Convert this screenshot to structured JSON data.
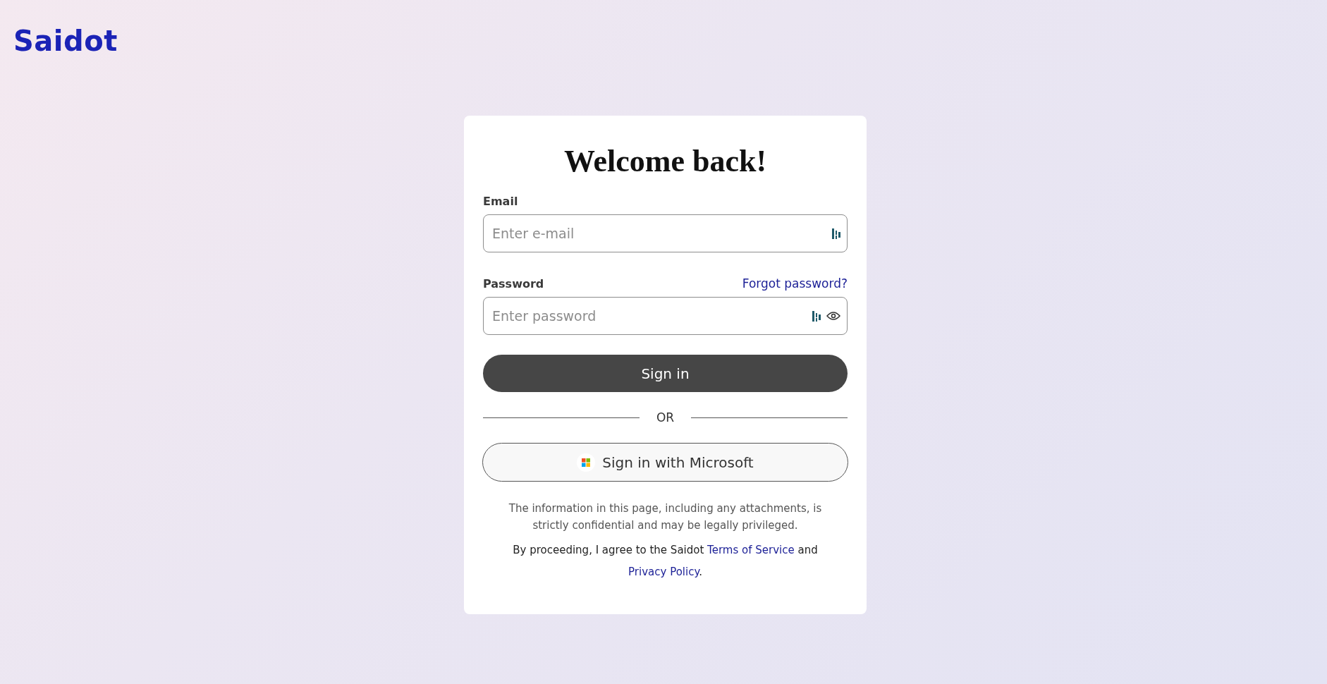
{
  "logo": {
    "text": "Saidot"
  },
  "card": {
    "title": "Welcome back!",
    "email": {
      "label": "Email",
      "placeholder": "Enter e-mail"
    },
    "password": {
      "label": "Password",
      "placeholder": "Enter password",
      "forgot_link": "Forgot password?"
    },
    "sign_in_button": "Sign in",
    "divider": "OR",
    "microsoft_button": "Sign in with Microsoft",
    "disclaimer": "The information in this page, including any attachments, is strictly confidential and may be legally privileged.",
    "agreement": {
      "text_before": "By proceeding, I agree to the Saidot",
      "terms_link": "Terms of Service",
      "text_between": "and",
      "privacy_link": "Privacy Policy",
      "text_after": "."
    }
  }
}
